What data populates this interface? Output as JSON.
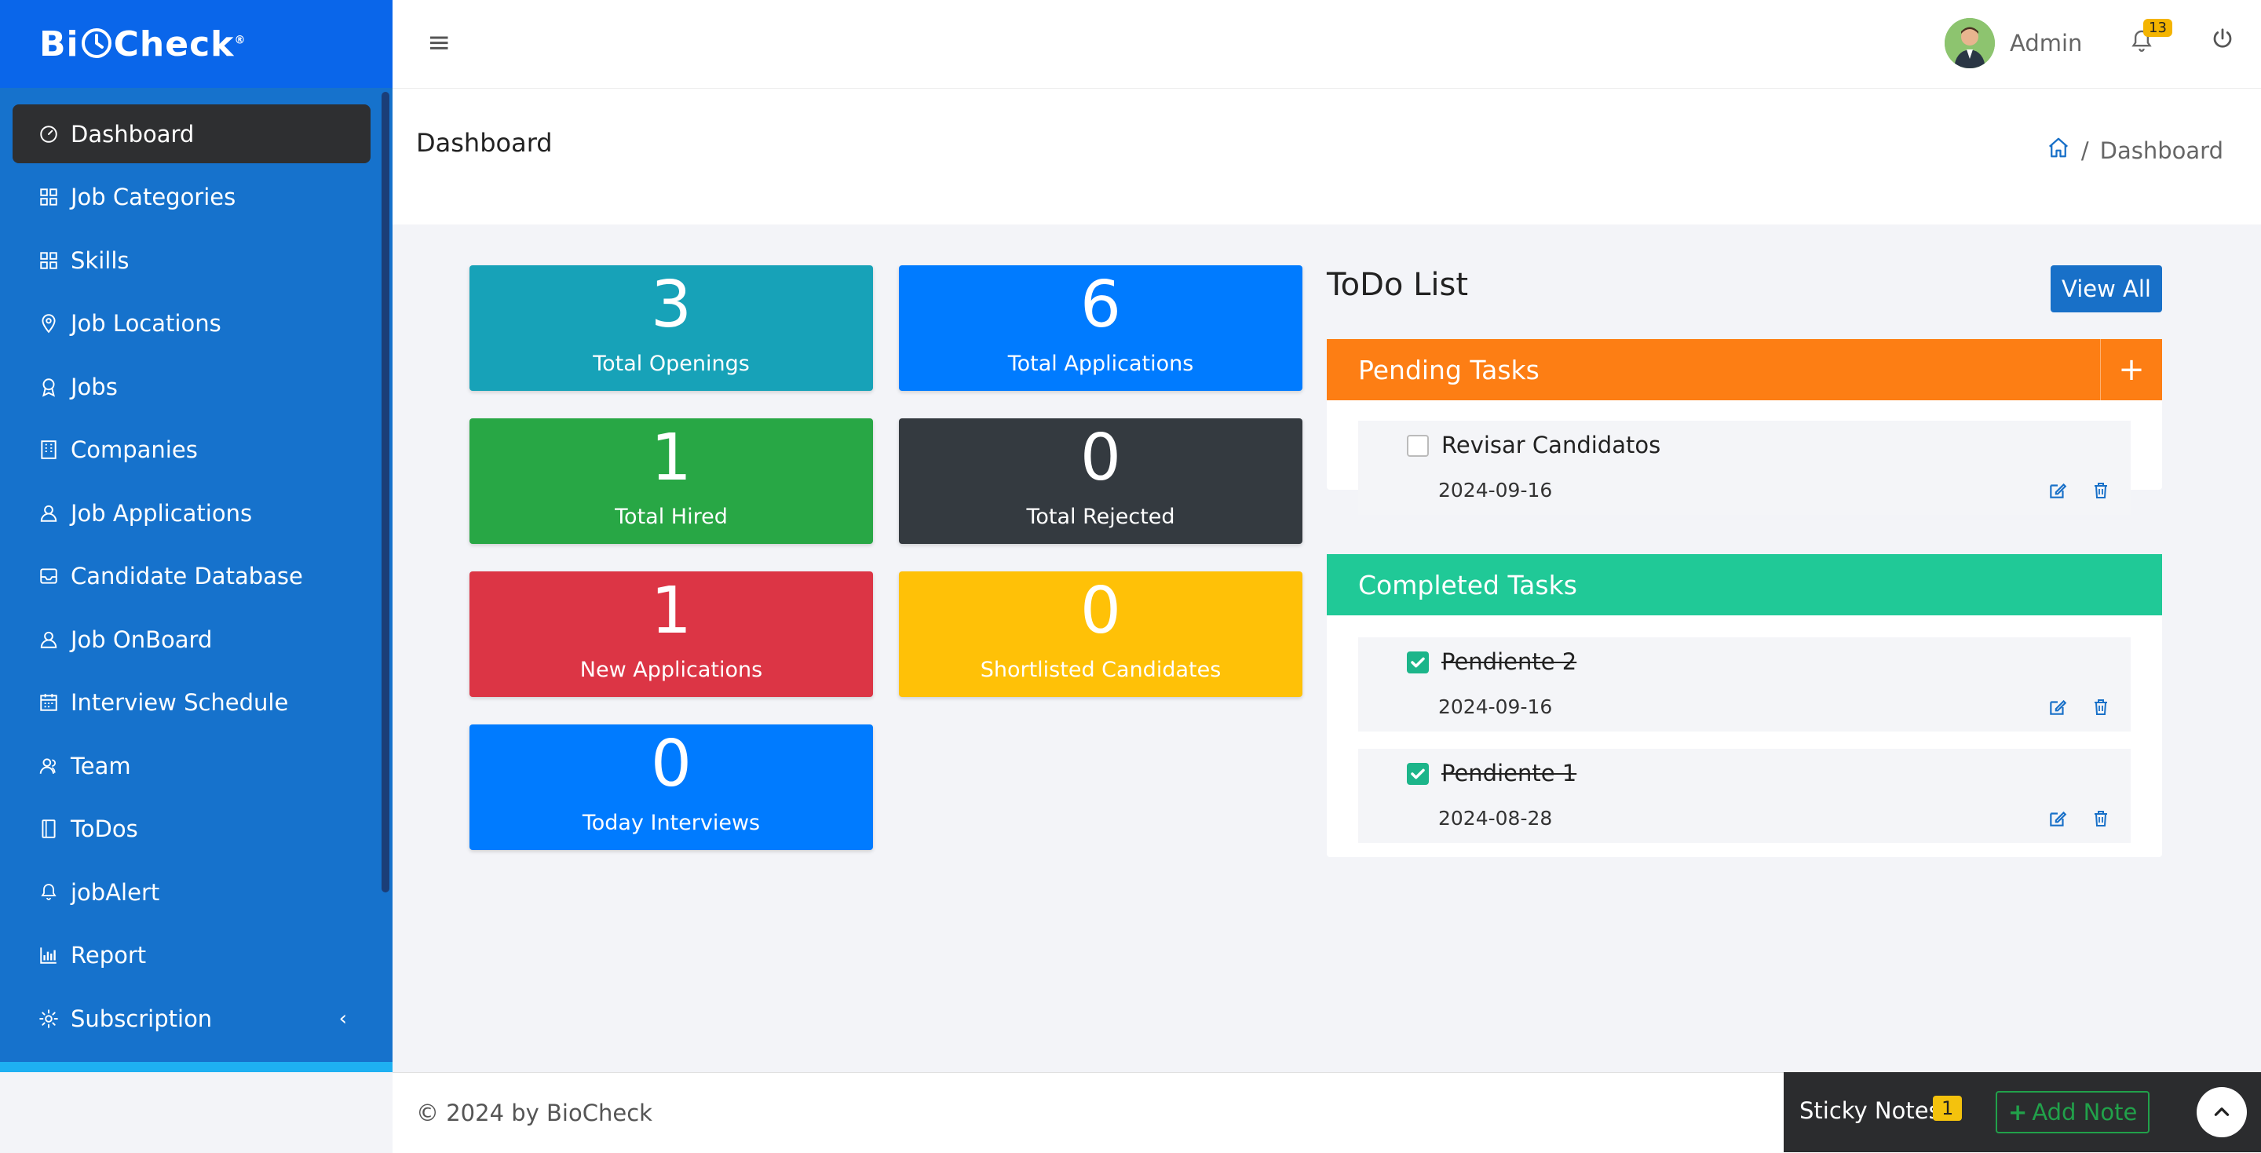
{
  "brand": {
    "name": "BiCheck",
    "mark": "®"
  },
  "sidebar": {
    "items": [
      {
        "label": "Dashboard",
        "icon": "dashboard-gauge-icon",
        "active": true
      },
      {
        "label": "Job Categories",
        "icon": "grid-icon"
      },
      {
        "label": "Skills",
        "icon": "grid-icon"
      },
      {
        "label": "Job Locations",
        "icon": "map-pin-icon"
      },
      {
        "label": "Jobs",
        "icon": "award-icon"
      },
      {
        "label": "Companies",
        "icon": "building-icon"
      },
      {
        "label": "Job Applications",
        "icon": "user-icon"
      },
      {
        "label": "Candidate Database",
        "icon": "inbox-icon"
      },
      {
        "label": "Job OnBoard",
        "icon": "user-icon"
      },
      {
        "label": "Interview Schedule",
        "icon": "calendar-icon"
      },
      {
        "label": "Team",
        "icon": "team-icon"
      },
      {
        "label": "ToDos",
        "icon": "notebook-icon"
      },
      {
        "label": "jobAlert",
        "icon": "bell-icon"
      },
      {
        "label": "Report",
        "icon": "bar-chart-icon"
      },
      {
        "label": "Subscription",
        "icon": "gear-icon",
        "chevron": "‹"
      }
    ]
  },
  "header": {
    "user_name": "Admin",
    "notification_count": "13"
  },
  "page": {
    "title": "Dashboard",
    "breadcrumb_sep": "/",
    "breadcrumb_current": "Dashboard"
  },
  "stats": [
    {
      "value": "3",
      "label": "Total Openings",
      "color": "#17a2b8"
    },
    {
      "value": "6",
      "label": "Total Applications",
      "color": "#007bff"
    },
    {
      "value": "1",
      "label": "Total Hired",
      "color": "#28a745"
    },
    {
      "value": "0",
      "label": "Total Rejected",
      "color": "#343a40"
    },
    {
      "value": "1",
      "label": "New Applications",
      "color": "#dc3545"
    },
    {
      "value": "0",
      "label": "Shortlisted Candidates",
      "color": "#ffc107"
    },
    {
      "value": "0",
      "label": "Today Interviews",
      "color": "#007bff"
    }
  ],
  "todo": {
    "title": "ToDo List",
    "view_all": "View All",
    "pending_title": "Pending Tasks",
    "pending_color": "#fd7e14",
    "completed_title": "Completed Tasks",
    "completed_color": "#20c997",
    "pending": [
      {
        "name": "Revisar Candidatos",
        "date": "2024-09-16",
        "done": false
      }
    ],
    "completed": [
      {
        "name": "Pendiente 2",
        "date": "2024-09-16",
        "done": true
      },
      {
        "name": "Pendiente 1",
        "date": "2024-08-28",
        "done": true
      }
    ]
  },
  "footer": {
    "copyright": "© 2024 by BioCheck",
    "sticky_label": "Sticky Notes",
    "sticky_count": "1",
    "add_note": "Add Note"
  }
}
